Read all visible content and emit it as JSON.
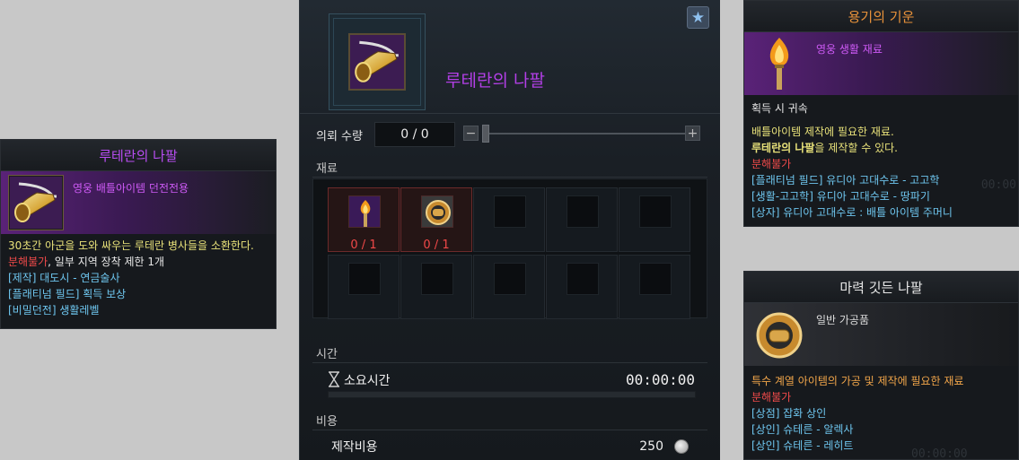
{
  "tooltip_left": {
    "title": "루테란의 나팔",
    "kind": "영웅 배틀아이템 던전전용",
    "lines": [
      {
        "a": "30초간 아군을 도와 싸우는 루테란 병사들을 소환한다.",
        "color": "yellow"
      },
      {
        "a": "분해불가",
        "b": ", 일부 지역 장착 제한 1개"
      },
      {
        "a": "[제작] 대도시 - 연금술사",
        "color": "cyan"
      },
      {
        "a": "[플래티넘 필드] 획득 보상",
        "color": "cyan"
      },
      {
        "a": "[비밀던전] 생활레벨",
        "color": "cyan"
      }
    ]
  },
  "craft": {
    "item_name": "루테란의 나팔",
    "favorite_icon": "star",
    "qty_label": "의뢰 수량",
    "qty_value": "0 / 0",
    "minus": "−",
    "plus": "+",
    "materials_label": "재료",
    "materials": [
      {
        "icon": "torch-icon",
        "count": "0 / 1"
      },
      {
        "icon": "gear-horn-icon",
        "count": "0 / 1"
      }
    ],
    "time_label": "시간",
    "time_row_label": "소요시간",
    "time_value": "00:00:00",
    "time_progress": 0,
    "cost_label": "비용",
    "cost_row_label": "제작비용",
    "cost_value": "250"
  },
  "tooltip_courage": {
    "title": "용기의 기운",
    "kind": "영웅 생활 재료",
    "bind": "획득 시 귀속",
    "desc1": "배틀아이템 제작에 필요한 재료.",
    "desc2_bold": "루테란의 나팔",
    "desc2_rest": "을 제작할 수 있다.",
    "no_dismantle": "분해불가",
    "sources": [
      "[플래티넘 필드] 유디아 고대수로 - 고고학",
      "[생활-고고학] 유디아 고대수로 - 땅파기",
      "[상자] 유디아 고대수로 : 배틀 아이템 주머니"
    ],
    "faint_time": "00:00"
  },
  "tooltip_magic": {
    "title": "마력 깃든 나팔",
    "kind": "일반 가공품",
    "desc": "특수 계열 아이템의 가공 및 제작에 필요한 재료",
    "no_dismantle": "분해불가",
    "sources": [
      "[상점] 잡화 상인",
      "[상인] 슈테른 - 알렉사",
      "[상인] 슈테른 - 레히트"
    ],
    "faint_time": "00:00:00"
  },
  "colors": {
    "epic_purple": "#b84df2",
    "rare_orange": "#e8923a",
    "red": "#f04a4a",
    "cyan": "#6ec6ef",
    "yellow": "#e9e27a"
  }
}
